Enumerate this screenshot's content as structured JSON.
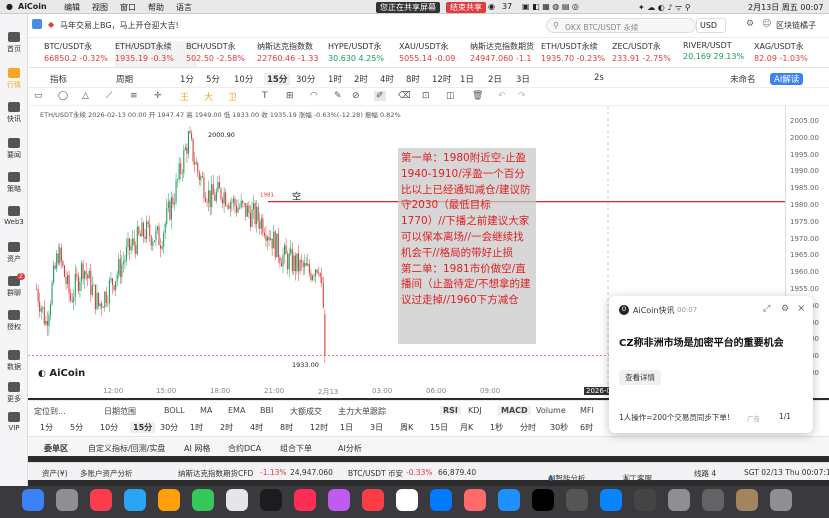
{
  "menubar": {
    "app": "AiCoin",
    "items": [
      "编辑",
      "视图",
      "窗口",
      "帮助",
      "语言"
    ],
    "screen_share": "您正在共享屏幕",
    "stop_share": "结束共享",
    "notif_count": "37",
    "clock": "2月13日 周五 00:07"
  },
  "topbar": {
    "announce": "马年交易上BG，马上开仓迎大吉!",
    "search_placeholder": "OKX BTC/USDT 永续",
    "currency": "USD",
    "user": "区块链橘子"
  },
  "sidebar": [
    {
      "label": "首页",
      "icon": "home-icon"
    },
    {
      "label": "行情",
      "icon": "chart-icon"
    },
    {
      "label": "快讯",
      "icon": "news-icon"
    },
    {
      "label": "要闻",
      "icon": "newspaper-icon"
    },
    {
      "label": "策略",
      "icon": "strategy-icon"
    },
    {
      "label": "Web3",
      "icon": "web3-icon"
    },
    {
      "label": "资产",
      "icon": "wallet-icon"
    },
    {
      "label": "群聊",
      "icon": "chat-icon",
      "badge": "2"
    },
    {
      "label": "授权",
      "icon": "key-icon"
    },
    {
      "label": "数据",
      "icon": "data-icon"
    },
    {
      "label": "更多",
      "icon": "more-icon"
    },
    {
      "label": "VIP",
      "icon": "vip-icon"
    }
  ],
  "tickers": [
    {
      "name": "BTC/USDT永",
      "price": "66850.2",
      "change": "-0.32%",
      "dir": "dn"
    },
    {
      "name": "ETH/USDT永续",
      "price": "1935.19",
      "change": "-0.3%",
      "dir": "dn"
    },
    {
      "name": "BCH/USDT永",
      "price": "502.50",
      "change": "-2.58%",
      "dir": "dn"
    },
    {
      "name": "纳斯达克指数数",
      "price": "22760.46",
      "change": "-1.33",
      "dir": "dn"
    },
    {
      "name": "HYPE/USDT永",
      "price": "30.630",
      "change": "4.25%",
      "dir": "up"
    },
    {
      "name": "XAU/USDT永",
      "price": "5055.14",
      "change": "-0.09",
      "dir": "dn"
    },
    {
      "name": "纳斯达克指数期货",
      "price": "24947.060",
      "change": "-1.1",
      "dir": "dn"
    },
    {
      "name": "ETH/USDT永续",
      "price": "1935.70",
      "change": "-0.23%",
      "dir": "dn"
    },
    {
      "name": "ZEC/USDT永",
      "price": "233.91",
      "change": "-2.75%",
      "dir": "dn"
    },
    {
      "name": "RIVER/USDT",
      "price": "20.169",
      "change": "29.13%",
      "dir": "up"
    },
    {
      "name": "XAG/USDT永",
      "price": "82.09",
      "change": "-1.03%",
      "dir": "dn"
    }
  ],
  "timeframes": [
    "指标",
    "周期",
    "1分",
    "5分",
    "10分",
    "15分",
    "30分",
    "1时",
    "2时",
    "4时",
    "8时",
    "12时",
    "1日",
    "2日",
    "3日"
  ],
  "tf_right": [
    "2s",
    "未命名",
    "AI解读"
  ],
  "chart": {
    "symbol_line": "ETH/USDT永续 2026-02-13 00:00 开 1947.47 高 1949.00 低 1933.00 收 1935.19 涨幅 -0.63%(-12.28) 振幅 0.82%",
    "high_label": "2000.90",
    "low_label": "1933.00",
    "level_label": "1981",
    "short_mark": "空",
    "yticks": [
      "2005.00",
      "2000.00",
      "1995.00",
      "1990.00",
      "1985.00",
      "1980.00",
      "1975.00",
      "1970.00",
      "1965.00",
      "1960.00",
      "1955.00",
      "1950.00",
      "1945.00",
      "1940.00",
      "1935.00",
      "1930.00"
    ],
    "xticks": [
      "12:00",
      "15:00",
      "18:00",
      "21:00",
      "2月13",
      "03:00",
      "06:00",
      "09:00"
    ],
    "watermark": "AiCoin",
    "time_cursor": "2026-02-"
  },
  "annotation": [
    "第一单：1980附近空-止盈1940-1910/浮盈一个百分比以上已经通知减仓/建议防守2030（最低目标1770）//下播之前建议大家可以保本离场//一会继续找机会干//格局的带好止损",
    "第二单：1981市价做空/直播间（止盈待定/不想拿的建议过走掉//1960下方减仓"
  ],
  "indicator_tabs": [
    "定位到...",
    "日期范围",
    "BOLL",
    "MA",
    "EMA",
    "BBI",
    "大额成交",
    "主力大单跟踪",
    "RSI",
    "KDJ",
    "MACD",
    "Volume",
    "MFI"
  ],
  "timeframes2": [
    "1分",
    "5分",
    "10分",
    "15分",
    "30分",
    "1时",
    "2时",
    "4时",
    "8时",
    "12时",
    "1日",
    "3日",
    "周K",
    "15日",
    "月K",
    "1秒",
    "分时",
    "30秒",
    "6时"
  ],
  "bottom_tabs": [
    "委单区",
    "自定义指标/回测/实盘",
    "AI 网格",
    "合约DCA",
    "组合下单",
    "AI分析"
  ],
  "status": {
    "assets": "资产(¥)",
    "multi": "多账户资产分析",
    "t1_name": "纳斯达克指数期货CFD",
    "t1_change": "-1.13%",
    "t1_price": "24,947.060",
    "t2_name": "BTC/USDT 币安",
    "t2_change": "-0.33%",
    "t2_price": "66,879.40",
    "ai_analyze": "AI智能分析",
    "service": "人工客服",
    "lines": "线路 4",
    "time": "SGT 02/13 Thu 00:07:12"
  },
  "news": {
    "source": "AiCoin快讯",
    "time": "00:07",
    "headline": "CZ称非洲市场是加密平台的重要机会",
    "detail_btn": "查看详情",
    "footer": "1人操作=200个交易员同步下单!",
    "ad": "广告",
    "page": "1/1"
  },
  "colors": {
    "accent": "#f5a623",
    "red": "#e23b3b",
    "green": "#17a05d",
    "annot_text": "#e02020"
  }
}
